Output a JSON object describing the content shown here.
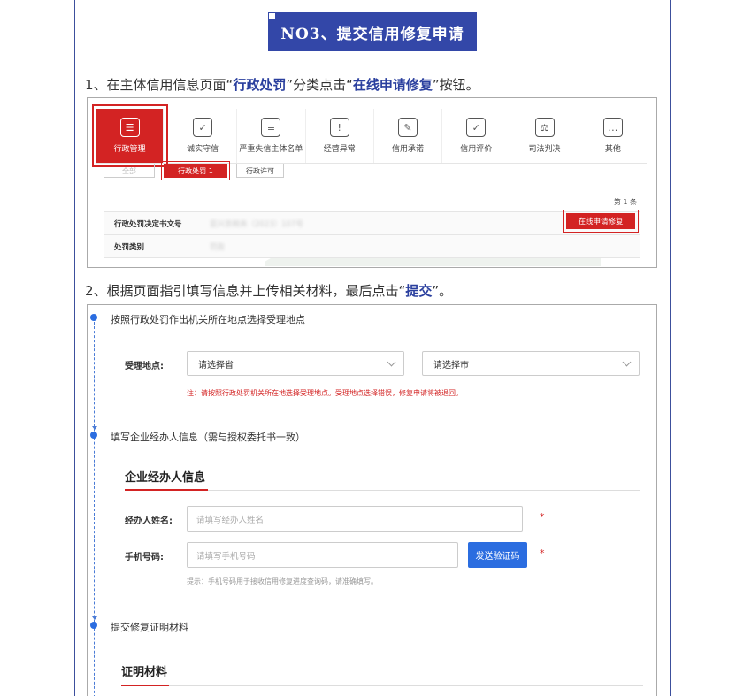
{
  "banner": {
    "title": "NO3、提交信用修复申请"
  },
  "steps": [
    {
      "prefix": "1、在主体信用信息页面“",
      "hl1": "行政处罚",
      "mid": "”分类点击“",
      "hl2": "在线申请修复",
      "suffix": "”按钮。"
    },
    {
      "prefix": "2、根据页面指引填写信息并上传相关材料，最后点击“",
      "hl1": "提交",
      "suffix": "”。"
    }
  ],
  "shot1": {
    "tabs": [
      {
        "label": "行政管理",
        "icon": "document-icon",
        "glyph": "☰",
        "active": true
      },
      {
        "label": "诚实守信",
        "icon": "shield-check-icon",
        "glyph": "✓",
        "active": false
      },
      {
        "label": "严重失信主体名单",
        "icon": "list-icon",
        "glyph": "≡",
        "active": false
      },
      {
        "label": "经营异常",
        "icon": "alarm-icon",
        "glyph": "!",
        "active": false
      },
      {
        "label": "信用承诺",
        "icon": "certificate-icon",
        "glyph": "✎",
        "active": false
      },
      {
        "label": "信用评价",
        "icon": "rating-icon",
        "glyph": "✓",
        "active": false
      },
      {
        "label": "司法判决",
        "icon": "judgment-icon",
        "glyph": "⚖",
        "active": false
      },
      {
        "label": "其他",
        "icon": "other-icon",
        "glyph": "…",
        "active": false
      }
    ],
    "subtabs": {
      "all": "全部",
      "penalty": "行政处罚  1",
      "license": "行政许可"
    },
    "count": "第 1 条",
    "rows": [
      {
        "key": "行政处罚决定书文号",
        "value": "亚兴京税务（2023）107号"
      },
      {
        "key": "处罚类别",
        "value": "罚款"
      }
    ],
    "apply_button": "在线申请修复"
  },
  "shot2": {
    "sections": {
      "s1": "按照行政处罚作出机关所在地点选择受理地点",
      "s2": "填写企业经办人信息（需与授权委托书一致）",
      "s3": "提交修复证明材料"
    },
    "location_label": "受理地点:",
    "province_select": "请选择省",
    "city_select": "请选择市",
    "location_note": "注：请按照行政处罚机关所在地选择受理地点。受理地点选择错误，修复申请将被退回。",
    "agent_head": "企业经办人信息",
    "name_label": "经办人姓名:",
    "name_placeholder": "请填写经办人姓名",
    "phone_label": "手机号码:",
    "phone_placeholder": "请填写手机号码",
    "send_code": "发送验证码",
    "required_mark": "*",
    "phone_hint": "提示：手机号码用于接收信用修复进度查询码，请准确填写。",
    "evidence_head": "证明材料"
  }
}
